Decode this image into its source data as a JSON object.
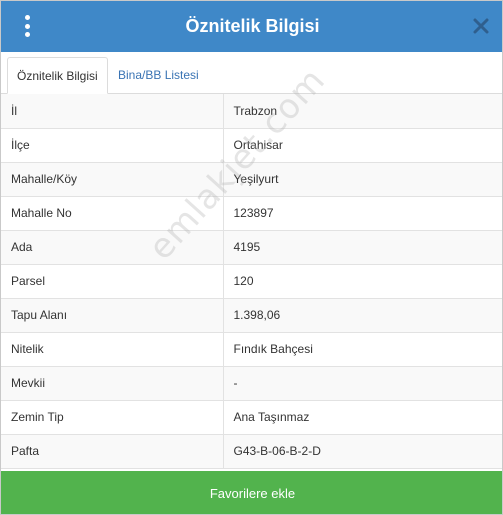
{
  "header": {
    "title": "Öznitelik Bilgisi",
    "menu_icon": "kebab-menu-icon",
    "close_icon": "close-icon"
  },
  "tabs": [
    {
      "label": "Öznitelik Bilgisi",
      "active": true
    },
    {
      "label": "Bina/BB Listesi",
      "active": false
    }
  ],
  "attributes": [
    {
      "key": "İl",
      "value": "Trabzon"
    },
    {
      "key": "İlçe",
      "value": "Ortahisar"
    },
    {
      "key": "Mahalle/Köy",
      "value": "Yeşilyurt"
    },
    {
      "key": "Mahalle No",
      "value": "123897"
    },
    {
      "key": "Ada",
      "value": "4195"
    },
    {
      "key": "Parsel",
      "value": "120"
    },
    {
      "key": "Tapu Alanı",
      "value": "1.398,06"
    },
    {
      "key": "Nitelik",
      "value": "Fındık Bahçesi"
    },
    {
      "key": "Mevkii",
      "value": "-"
    },
    {
      "key": "Zemin Tip",
      "value": "Ana Taşınmaz"
    },
    {
      "key": "Pafta",
      "value": "G43-B-06-B-2-D"
    }
  ],
  "watermark": "emlakjet.com",
  "footer": {
    "favorite_label": "Favorilere ekle"
  },
  "colors": {
    "header_bg": "#3f88c8",
    "button_bg": "#52b34d",
    "tab_link": "#3a74b4"
  }
}
